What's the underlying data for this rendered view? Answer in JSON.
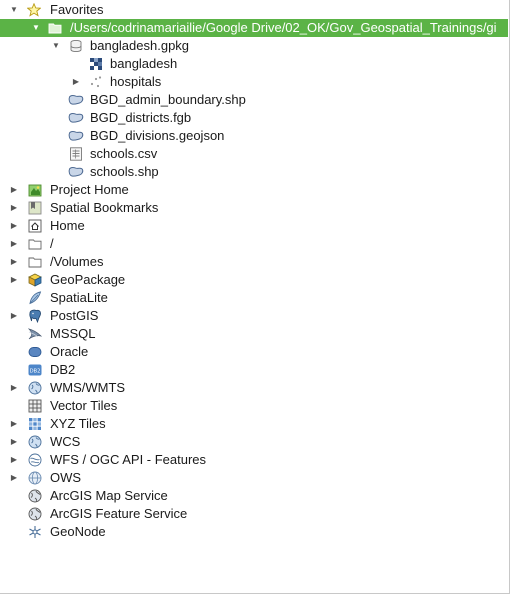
{
  "browser": {
    "favorites": {
      "label": "Favorites",
      "folder": {
        "path": "/Users/codrinamariailie/Google Drive/02_OK/Gov_Geospatial_Trainings/gi",
        "children": {
          "gpkg": {
            "label": "bangladesh.gpkg",
            "layers": [
              "bangladesh",
              "hospitals"
            ]
          },
          "files": [
            "BGD_admin_boundary.shp",
            "BGD_districts.fgb",
            "BGD_divisions.geojson",
            "schools.csv",
            "schools.shp"
          ]
        }
      }
    },
    "roots": [
      "Project Home",
      "Spatial Bookmarks",
      "Home",
      "/",
      "/Volumes",
      "GeoPackage",
      "SpatiaLite",
      "PostGIS",
      "MSSQL",
      "Oracle",
      "DB2",
      "WMS/WMTS",
      "Vector Tiles",
      "XYZ Tiles",
      "WCS",
      "WFS / OGC API - Features",
      "OWS",
      "ArcGIS Map Service",
      "ArcGIS Feature Service",
      "GeoNode"
    ]
  },
  "colors": {
    "selection": "#5bb346"
  },
  "icons": {
    "favorites": "star-icon",
    "folder": "folder-icon",
    "gpkg": "database-icon",
    "raster": "raster-layer-icon",
    "points": "point-layer-icon",
    "vector": "vector-file-icon",
    "csv": "csv-file-icon"
  }
}
